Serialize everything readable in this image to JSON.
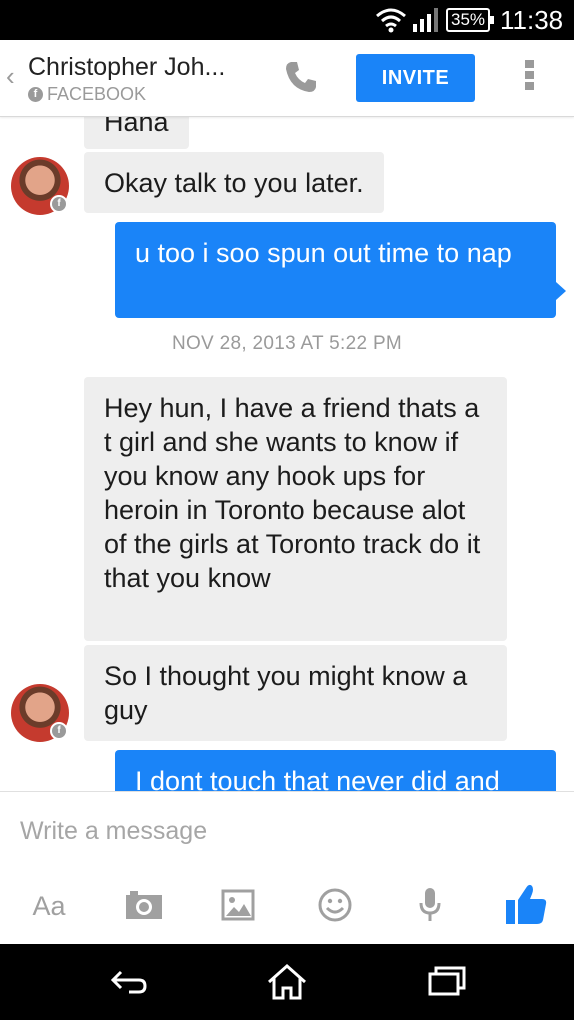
{
  "status_bar": {
    "battery": "35%",
    "time": "11:38",
    "icons": [
      "wifi-icon",
      "signal-icon",
      "battery-icon"
    ]
  },
  "header": {
    "contact_name": "Christopher Joh...",
    "source": "FACEBOOK",
    "invite_label": "INVITE",
    "icons": [
      "back-chevron-icon",
      "facebook-icon",
      "phone-icon",
      "more-vert-icon"
    ]
  },
  "conversation": {
    "messages": [
      {
        "from": "contact",
        "text": "Haha"
      },
      {
        "from": "contact",
        "text": "Okay talk to you later."
      },
      {
        "from": "me",
        "text": "u too i soo spun out time to nap"
      },
      {
        "type": "timestamp",
        "text": "NOV 28, 2013 AT 5:22 PM"
      },
      {
        "from": "contact",
        "text": "Hey hun, I have a friend thats a t girl and she wants to know if you know any hook ups for heroin in Toronto because alot of the girls at Toronto track do it that you know"
      },
      {
        "from": "contact",
        "text": "So I thought you might know a guy"
      },
      {
        "from": "me",
        "text": "I dont touch that never did and"
      }
    ]
  },
  "composer": {
    "placeholder": "Write a message",
    "font_label": "Aa",
    "icons": [
      "camera-icon",
      "image-icon",
      "emoji-icon",
      "microphone-icon",
      "thumbs-up-icon"
    ]
  },
  "nav_bar": {
    "icons": [
      "back-icon",
      "home-icon",
      "recents-icon"
    ]
  },
  "colors": {
    "accent": "#1a84f8",
    "incoming_bubble": "#eeeeee",
    "muted_text": "#9a9a9a"
  }
}
